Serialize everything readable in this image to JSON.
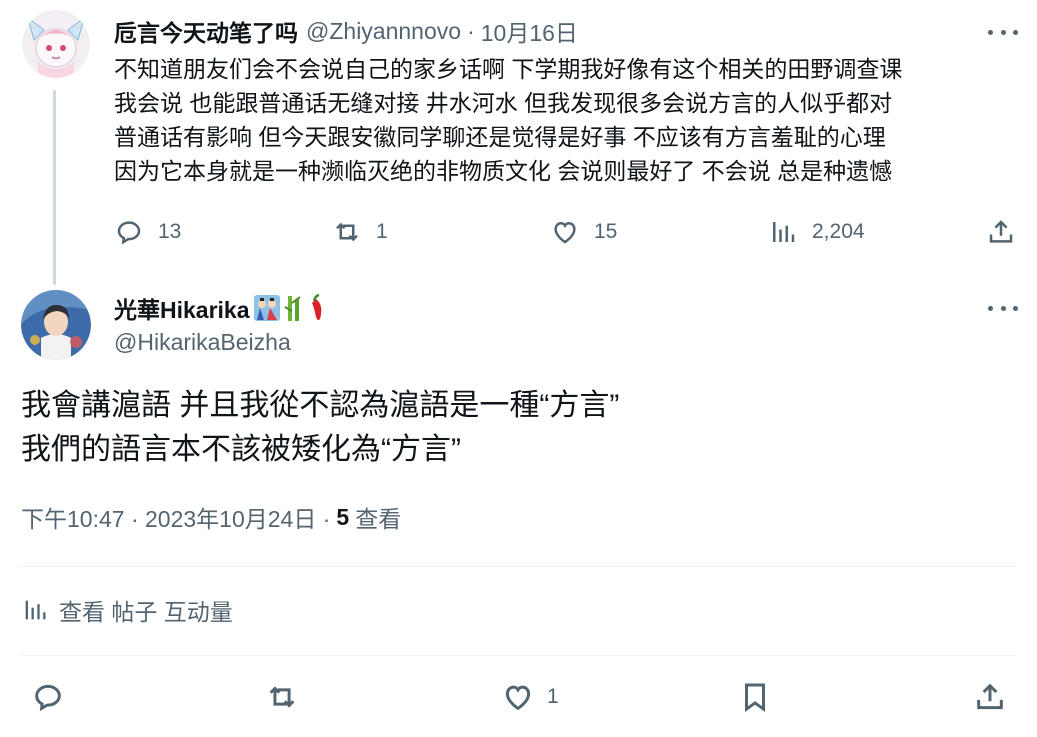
{
  "parent_tweet": {
    "display_name": "卮言今天动笔了吗",
    "handle": "@Zhiyannnovo",
    "separator": "·",
    "date": "10月16日",
    "text_lines": [
      "不知道朋友们会不会说自己的家乡话啊 下学期我好像有这个相关的田野调查课",
      "我会说 也能跟普通话无缝对接 井水河水 但我发现很多会说方言的人似乎都对",
      "普通话有影响  但今天跟安徽同学聊还是觉得是好事 不应该有方言羞耻的心理",
      "因为它本身就是一种濒临灭绝的非物质文化 会说则最好了 不会说 总是种遗憾"
    ],
    "replies": "13",
    "reposts": "1",
    "likes": "15",
    "views": "2,204"
  },
  "reply_tweet": {
    "display_name": "光華Hikarika",
    "handle": "@HikarikaBeizha",
    "text_lines": [
      "我會講滬語 并且我從不認為滬語是一種“方言”",
      "我們的語言本不該被矮化為“方言”"
    ],
    "timestamp": "下午10:47 · 2023年10月24日 ·",
    "views_count": "5",
    "views_label": "查看",
    "engagement_label": "查看 帖子 互动量",
    "likes": "1"
  },
  "icons": {
    "reply": "reply-icon",
    "repost": "repost-icon",
    "like": "heart-icon",
    "views": "analytics-icon",
    "share": "share-icon",
    "bookmark": "bookmark-icon",
    "more": "more-icon"
  },
  "colors": {
    "text_primary": "#0f1419",
    "text_secondary": "#536471",
    "thread_line": "#cfd9de",
    "divider": "#eff3f4"
  }
}
